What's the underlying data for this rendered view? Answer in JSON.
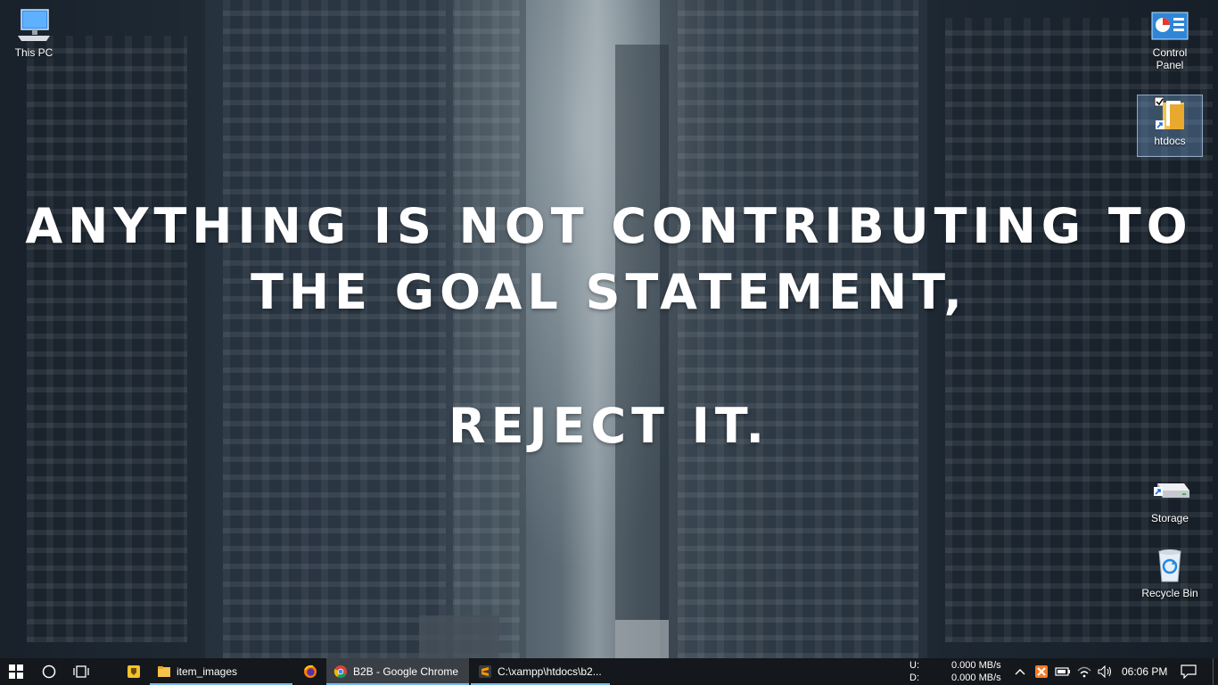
{
  "desktop": {
    "quote_line1": "ANYTHING IS NOT CONTRIBUTING TO",
    "quote_line2": "THE GOAL STATEMENT,",
    "quote_line3": "REJECT IT.",
    "icons": [
      {
        "label": "This PC",
        "icon": "computer-icon"
      },
      {
        "label": "Control Panel",
        "icon": "control-panel-icon"
      },
      {
        "label": "htdocs",
        "icon": "folder-shortcut-icon"
      },
      {
        "label": "Storage",
        "icon": "drive-shortcut-icon"
      },
      {
        "label": "Recycle Bin",
        "icon": "recycle-bin-icon"
      }
    ]
  },
  "taskbar": {
    "apps": [
      {
        "label": "item_images",
        "icon": "folder-icon"
      },
      {
        "label": "B2B - Google Chrome",
        "icon": "chrome-icon"
      },
      {
        "label": "C:\\xampp\\htdocs\\b2...",
        "icon": "sublime-icon"
      }
    ],
    "disk_u_label": "U:",
    "disk_d_label": "D:",
    "disk_u_rate": "0.000 MB/s",
    "disk_d_rate": "0.000 MB/s",
    "clock": "06:06 PM"
  },
  "colors": {
    "taskbar_bg": "#14171b",
    "active_underline": "#76b9ed",
    "windows_blue": "#3a8ee6"
  }
}
